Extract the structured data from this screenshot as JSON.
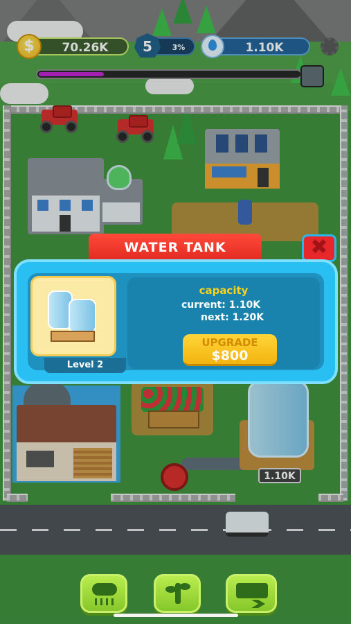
{
  "hud": {
    "coins": "70.26K",
    "level": "5",
    "level_progress": "3%",
    "level_progress_value": 0.03,
    "water": "1.10K",
    "world_progress_value": 0.25,
    "coin_icon": "dollar-coin-icon",
    "water_icon": "water-drop-icon",
    "settings_icon": "gear-icon"
  },
  "modal": {
    "title": "WATER TANK",
    "close_icon": "close-x-icon",
    "item_level": "Level 2",
    "capacity_title": "capacity",
    "current_label": "current:",
    "current_value": "1.10K",
    "next_label": "next:",
    "next_value": "1.20K",
    "upgrade_label": "UPGRADE",
    "upgrade_price": "$800"
  },
  "scene": {
    "tank_capacity_label": "1.10K"
  },
  "toolbar": {
    "buttons": [
      {
        "icon": "rain-cloud-icon"
      },
      {
        "icon": "plant-sprout-icon"
      },
      {
        "icon": "delivery-truck-icon"
      }
    ]
  },
  "colors": {
    "accent_red": "#e12a20",
    "panel_blue": "#29bff2",
    "gold": "#ffd21c",
    "button_green": "#86c72a"
  }
}
